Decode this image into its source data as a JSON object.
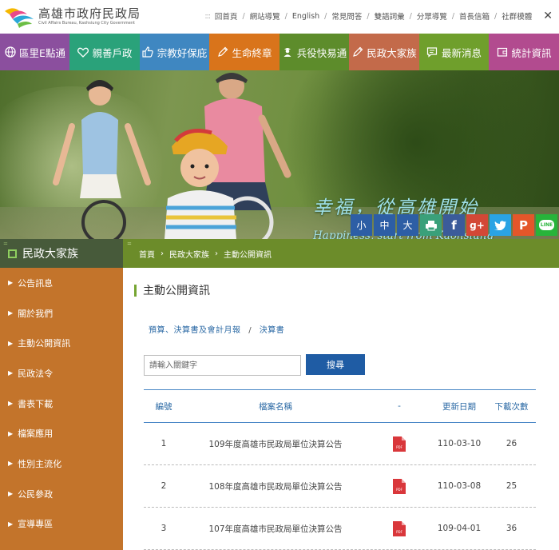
{
  "header": {
    "title": "高雄市政府民政局",
    "subtitle": "Civil Affairs Bureau, Kaohsiung City Government",
    "topnav": [
      "回首頁",
      "網站導覽",
      "English",
      "常見問答",
      "雙語詞彙",
      "分眾導覽",
      "首長信箱",
      "社群模體"
    ]
  },
  "mainmenu": [
    {
      "label": "區里E點通",
      "icon": "globe-icon",
      "color": "#8b4f9e"
    },
    {
      "label": "親善戶政",
      "icon": "heart-icon",
      "color": "#2aa27a"
    },
    {
      "label": "宗教好保庇",
      "icon": "thumbs-up-icon",
      "color": "#3f87c1"
    },
    {
      "label": "生命終章",
      "icon": "pencil-icon",
      "color": "#d9741b"
    },
    {
      "label": "兵役快易通",
      "icon": "soldier-icon",
      "color": "#5d8c2b"
    },
    {
      "label": "民政大家族",
      "icon": "pencil-icon",
      "color": "#c36a4a"
    },
    {
      "label": "最新消息",
      "icon": "chat-icon",
      "color": "#6f9f2c"
    },
    {
      "label": "統計資訊",
      "icon": "wallet-icon",
      "color": "#b24b8f"
    }
  ],
  "banner": {
    "slogan_zh": "幸福，從高雄開始",
    "slogan_en": "Happiness, start from Kaohsiung"
  },
  "social": [
    {
      "label": "小",
      "icon": "font-small",
      "color": "#2d5ea5"
    },
    {
      "label": "中",
      "icon": "font-medium",
      "color": "#2d5ea5"
    },
    {
      "label": "大",
      "icon": "font-large",
      "color": "#2d5ea5"
    },
    {
      "label": "",
      "icon": "print-icon",
      "color": "#3aa07a"
    },
    {
      "label": "f",
      "icon": "facebook-icon",
      "color": "#3b5b9a"
    },
    {
      "label": "g+",
      "icon": "google-plus-icon",
      "color": "#d34836"
    },
    {
      "label": "",
      "icon": "twitter-icon",
      "color": "#2aa3e4"
    },
    {
      "label": "P",
      "icon": "plurk-icon",
      "color": "#e4562a"
    },
    {
      "label": "LINE",
      "icon": "line-icon",
      "color": "#27b43a"
    }
  ],
  "sidebar": {
    "title": "民政大家族",
    "items": [
      "公告訊息",
      "關於我們",
      "主動公開資訊",
      "民政法令",
      "書表下載",
      "檔案應用",
      "性別主流化",
      "公民參政",
      "宣導專區"
    ]
  },
  "breadcrumb": [
    "首頁",
    "民政大家族",
    "主動公開資訊"
  ],
  "content": {
    "title": "主動公開資訊",
    "subcrumb": [
      "預算、決算書及會計月報",
      "決算書"
    ],
    "search_placeholder": "請輸入關鍵字",
    "search_button": "搜尋"
  },
  "table": {
    "headers": [
      "編號",
      "檔案名稱",
      "-",
      "更新日期",
      "下載次數"
    ],
    "rows": [
      {
        "no": "1",
        "name": "109年度高雄市民政局單位決算公告",
        "date": "110-03-10",
        "count": "26"
      },
      {
        "no": "2",
        "name": "108年度高雄市民政局單位決算公告",
        "date": "110-03-08",
        "count": "25"
      },
      {
        "no": "3",
        "name": "107年度高雄市民政局單位決算公告",
        "date": "109-04-01",
        "count": "36"
      }
    ]
  }
}
